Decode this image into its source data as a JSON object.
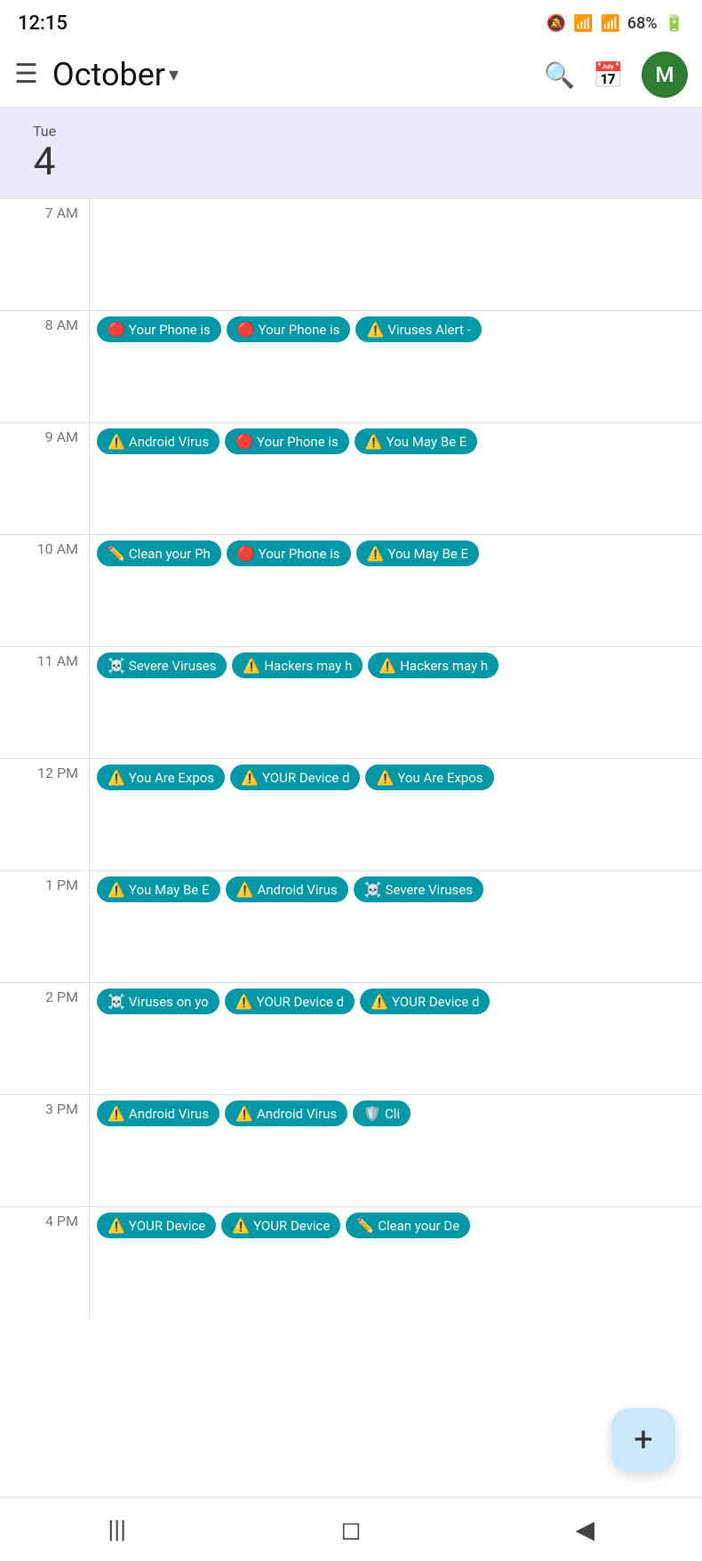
{
  "statusBar": {
    "time": "12:15",
    "battery": "68%",
    "icons": [
      "🔕",
      "📶",
      "📶",
      "🔋"
    ]
  },
  "appBar": {
    "menuLabel": "☰",
    "title": "October",
    "dropdownArrow": "▾",
    "searchIcon": "🔍",
    "calendarIcon": "📅",
    "avatarLabel": "M"
  },
  "dayHeader": {
    "dayName": "Tue",
    "dayNumber": "4"
  },
  "timeSlots": [
    {
      "label": "7 AM",
      "events": []
    },
    {
      "label": "8 AM",
      "events": [
        {
          "icon": "🔴",
          "text": "Your Phone is"
        },
        {
          "icon": "🔴",
          "text": "Your Phone is"
        },
        {
          "icon": "⚠️",
          "text": "Viruses Alert -"
        }
      ]
    },
    {
      "label": "9 AM",
      "events": [
        {
          "icon": "⚠️",
          "text": "Android Virus"
        },
        {
          "icon": "🔴",
          "text": "Your Phone is"
        },
        {
          "icon": "⚠️",
          "text": "You May Be E"
        }
      ]
    },
    {
      "label": "10 AM",
      "events": [
        {
          "icon": "✏️",
          "text": "Clean your Ph"
        },
        {
          "icon": "🔴",
          "text": "Your Phone is"
        },
        {
          "icon": "⚠️",
          "text": "You May Be E"
        }
      ]
    },
    {
      "label": "11 AM",
      "events": [
        {
          "icon": "☠️",
          "text": "Severe Viruses"
        },
        {
          "icon": "⚠️",
          "text": "Hackers may h"
        },
        {
          "icon": "⚠️",
          "text": "Hackers may h"
        }
      ]
    },
    {
      "label": "12 PM",
      "events": [
        {
          "icon": "⚠️",
          "text": "You Are Expos"
        },
        {
          "icon": "⚠️",
          "text": "YOUR Device d"
        },
        {
          "icon": "⚠️",
          "text": "You Are Expos"
        }
      ]
    },
    {
      "label": "1 PM",
      "events": [
        {
          "icon": "⚠️",
          "text": "You May Be E"
        },
        {
          "icon": "⚠️",
          "text": "Android Virus"
        },
        {
          "icon": "☠️",
          "text": "Severe Viruses"
        }
      ]
    },
    {
      "label": "2 PM",
      "events": [
        {
          "icon": "☠️",
          "text": "Viruses on yo"
        },
        {
          "icon": "⚠️",
          "text": "YOUR Device d"
        },
        {
          "icon": "⚠️",
          "text": "YOUR Device d"
        }
      ]
    },
    {
      "label": "3 PM",
      "events": [
        {
          "icon": "⚠️",
          "text": "Android Virus"
        },
        {
          "icon": "⚠️",
          "text": "Android Virus"
        },
        {
          "icon": "🛡️",
          "text": "Cli"
        }
      ]
    },
    {
      "label": "4 PM",
      "events": [
        {
          "icon": "⚠️",
          "text": "YOUR Device"
        },
        {
          "icon": "⚠️",
          "text": "YOUR Device"
        },
        {
          "icon": "✏️",
          "text": "Clean your De"
        }
      ]
    }
  ],
  "fab": {
    "label": "+"
  },
  "bottomNav": {
    "back": "◀",
    "home": "◻",
    "recent": "|||"
  }
}
